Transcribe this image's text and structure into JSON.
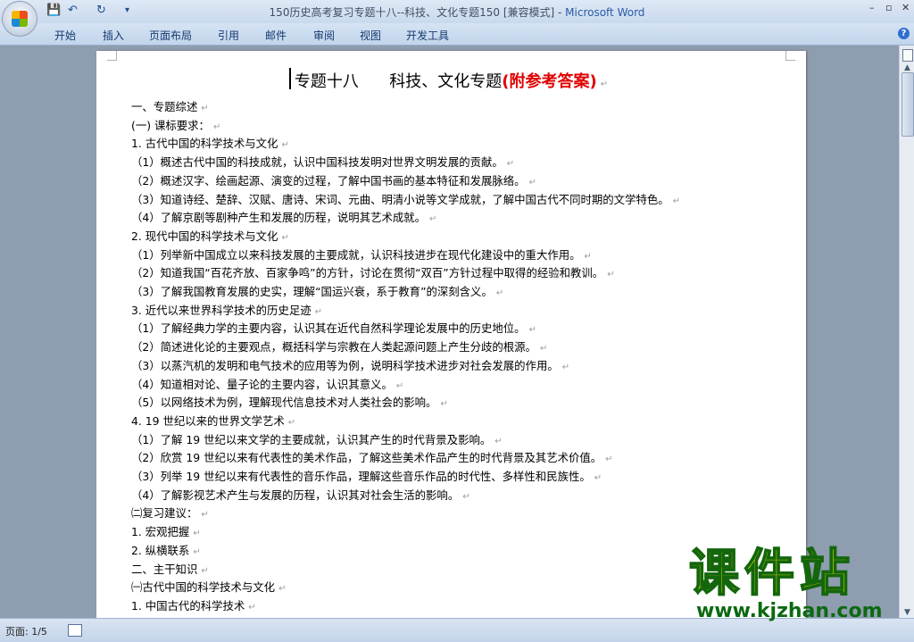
{
  "window": {
    "title": "150历史高考复习专题十八--科技、文化专题150 [兼容模式] - ",
    "app_name": "Microsoft Word",
    "minimize": "–",
    "restore": "▫",
    "close": "✕"
  },
  "quick_access": {
    "save": "💾",
    "undo": "↶",
    "redo": "↻",
    "more": "▾"
  },
  "ribbon": {
    "tabs": [
      "开始",
      "插入",
      "页面布局",
      "引用",
      "邮件",
      "审阅",
      "视图",
      "开发工具"
    ],
    "help": "?"
  },
  "document": {
    "title_main": "专题十八      科技、文化专题",
    "title_red": "(附参考答案)",
    "paragraph_mark": "↵",
    "lines": [
      "一、专题综述",
      "(一) 课标要求：",
      "1. 古代中国的科学技术与文化",
      "（1）概述古代中国的科技成就，认识中国科技发明对世界文明发展的贡献。",
      "（2）概述汉字、绘画起源、演变的过程，了解中国书画的基本特征和发展脉络。",
      "（3）知道诗经、楚辞、汉赋、唐诗、宋词、元曲、明清小说等文学成就，了解中国古代不同时期的文学特色。",
      "（4）了解京剧等剧种产生和发展的历程，说明其艺术成就。",
      "2. 现代中国的科学技术与文化",
      "（1）列举新中国成立以来科技发展的主要成就，认识科技进步在现代化建设中的重大作用。",
      "（2）知道我国“百花齐放、百家争鸣”的方针，讨论在贯彻“双百”方针过程中取得的经验和教训。",
      "（3）了解我国教育发展的史实，理解“国运兴衰，系于教育”的深刻含义。",
      "3. 近代以来世界科学技术的历史足迹",
      "（1）了解经典力学的主要内容，认识其在近代自然科学理论发展中的历史地位。",
      "（2）简述进化论的主要观点，概括科学与宗教在人类起源问题上产生分歧的根源。",
      "（3）以蒸汽机的发明和电气技术的应用等为例，说明科学技术进步对社会发展的作用。",
      "（4）知道相对论、量子论的主要内容，认识其意义。",
      "（5）以网络技术为例，理解现代信息技术对人类社会的影响。",
      "4. 19 世纪以来的世界文学艺术",
      "（1）了解 19 世纪以来文学的主要成就，认识其产生的时代背景及影响。",
      "（2）欣赏 19 世纪以来有代表性的美术作品，了解这些美术作品产生的时代背景及其艺术价值。",
      "（3）列举 19 世纪以来有代表性的音乐作品，理解这些音乐作品的时代性、多样性和民族性。",
      "（4）了解影视艺术产生与发展的历程，认识其对社会生活的影响。",
      "㈡复习建议：",
      "1. 宏观把握",
      "2. 纵横联系",
      "二、主干知识",
      "㈠古代中国的科学技术与文化",
      "1. 中国古代的科学技术"
    ]
  },
  "statusbar": {
    "page": "页面: 1/5"
  },
  "watermark": {
    "main": "课件站",
    "url": "www.kjzhan.com"
  }
}
